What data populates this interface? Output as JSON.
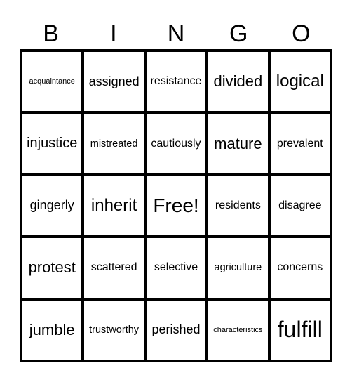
{
  "header": {
    "letters": [
      "B",
      "I",
      "N",
      "G",
      "O"
    ]
  },
  "card": {
    "rows": [
      [
        "acquaintance",
        "assigned",
        "resistance",
        "divided",
        "logical"
      ],
      [
        "injustice",
        "mistreated",
        "cautiously",
        "mature",
        "prevalent"
      ],
      [
        "gingerly",
        "inherit",
        "Free!",
        "residents",
        "disagree"
      ],
      [
        "protest",
        "scattered",
        "selective",
        "agriculture",
        "concerns"
      ],
      [
        "jumble",
        "trustworthy",
        "perished",
        "characteristics",
        "fulfill"
      ]
    ],
    "free_space": "Free!"
  }
}
